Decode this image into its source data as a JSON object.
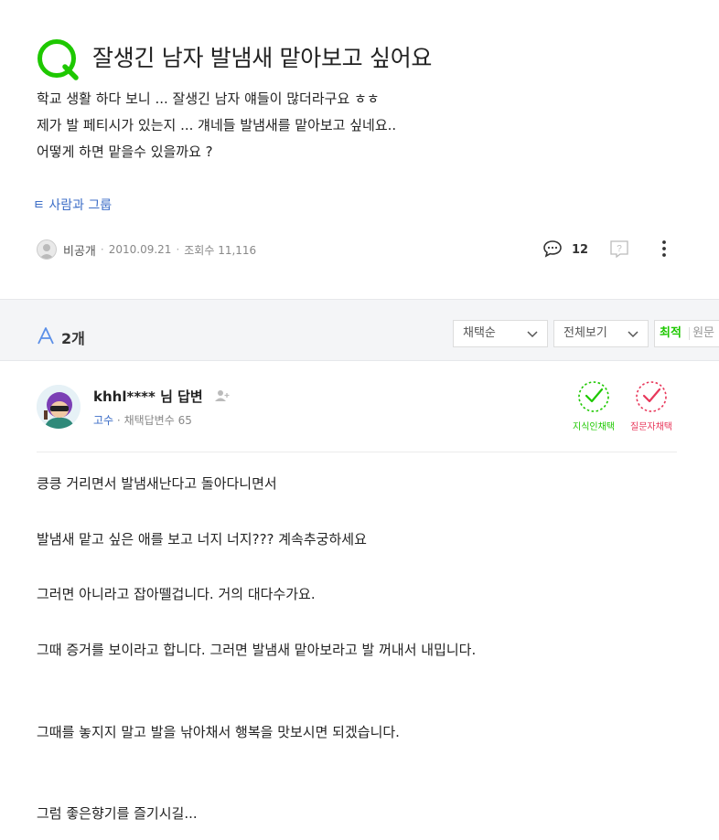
{
  "question": {
    "title": "잘생긴 남자 발냄새 맡아보고 싶어요",
    "body_lines": [
      "학교 생활 하다 보니 ... 잘생긴 남자 얘들이 많더라구요 ㅎㅎ",
      "제가 발 페티시가 있는지 ... 걔네들 발냄새를 맡아보고 싶네요..",
      "어떻게 하면 맡을수 있을까요 ?"
    ],
    "tag": "ㅌ 사람과 그룹",
    "author": "비공개",
    "date": "2010.09.21",
    "views": "조회수 11,116",
    "comment_count": "12"
  },
  "answers_bar": {
    "count": "2개",
    "sort_select": "채택순",
    "filter_select": "전체보기",
    "sort_latest": "최적",
    "sort_original": "원문"
  },
  "answer": {
    "author": "khhl**** 님 답변",
    "grade": "고수",
    "adopted": "채택답변수 65",
    "badge_expert": "지식인채택",
    "badge_asker": "질문자채택",
    "lines": [
      "킁킁 거리면서 발냄새난다고 돌아다니면서",
      "발냄새 맡고 싶은 애를 보고 너지 너지??? 계속추궁하세요",
      "그러면 아니라고 잡아뗄겁니다. 거의 대다수가요.",
      "그때 증거를 보이라고 합니다. 그러면 발냄새 맡아보라고 발 꺼내서 내밉니다.",
      "그때를 놓지지 말고 발을 낚아채서 행복을 맛보시면 되겠습니다.",
      "그럼 좋은향기를 즐기시길..."
    ]
  },
  "colors": {
    "brand_green": "#1ec800",
    "link_blue": "#3d6ec7",
    "asker_red": "#e8385b"
  }
}
